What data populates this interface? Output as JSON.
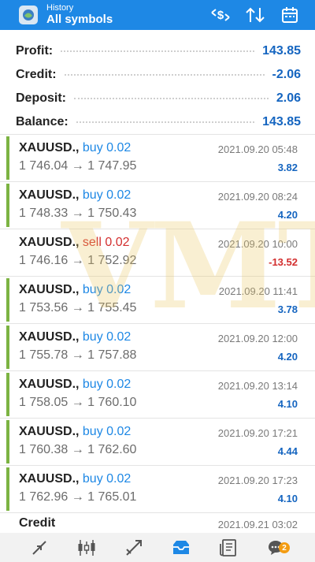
{
  "header": {
    "supertitle": "History",
    "title": "All symbols",
    "icons": [
      "currency-filter-icon",
      "sort-icon",
      "calendar-icon"
    ]
  },
  "summary": {
    "profit": {
      "label": "Profit:",
      "value": "143.85"
    },
    "credit": {
      "label": "Credit:",
      "value": "-2.06"
    },
    "deposit": {
      "label": "Deposit:",
      "value": "2.06"
    },
    "balance": {
      "label": "Balance:",
      "value": "143.85"
    }
  },
  "deals": [
    {
      "symbol": "XAUUSD.,",
      "action": "buy 0.02",
      "type": "buy",
      "prices": "1 746.04 → 1 747.95",
      "time": "2021.09.20 05:48",
      "profit": "3.82"
    },
    {
      "symbol": "XAUUSD.,",
      "action": "buy 0.02",
      "type": "buy",
      "prices": "1 748.33 → 1 750.43",
      "time": "2021.09.20 08:24",
      "profit": "4.20"
    },
    {
      "symbol": "XAUUSD.,",
      "action": "sell 0.02",
      "type": "sell",
      "prices": "1 746.16 → 1 752.92",
      "time": "2021.09.20 10:00",
      "profit": "-13.52"
    },
    {
      "symbol": "XAUUSD.,",
      "action": "buy 0.02",
      "type": "buy",
      "prices": "1 753.56 → 1 755.45",
      "time": "2021.09.20 11:41",
      "profit": "3.78"
    },
    {
      "symbol": "XAUUSD.,",
      "action": "buy 0.02",
      "type": "buy",
      "prices": "1 755.78 → 1 757.88",
      "time": "2021.09.20 12:00",
      "profit": "4.20"
    },
    {
      "symbol": "XAUUSD.,",
      "action": "buy 0.02",
      "type": "buy",
      "prices": "1 758.05 → 1 760.10",
      "time": "2021.09.20 13:14",
      "profit": "4.10"
    },
    {
      "symbol": "XAUUSD.,",
      "action": "buy 0.02",
      "type": "buy",
      "prices": "1 760.38 → 1 762.60",
      "time": "2021.09.20 17:21",
      "profit": "4.44"
    },
    {
      "symbol": "XAUUSD.,",
      "action": "buy 0.02",
      "type": "buy",
      "prices": "1 762.96 → 1 765.01",
      "time": "2021.09.20 17:23",
      "profit": "4.10"
    }
  ],
  "credit_entry": {
    "label": "Credit",
    "time": "2021.09.21 03:02"
  },
  "watermark": "VMT",
  "bottom_nav": {
    "items": [
      "quotes-icon",
      "chart-icon",
      "trade-icon",
      "history-icon",
      "news-icon",
      "messages-icon"
    ],
    "active": "history-icon",
    "messages_badge": "2"
  },
  "colors": {
    "header": "#1e88e5",
    "buy": "#1e88e5",
    "sell": "#d32f2f",
    "profit_positive": "#1565c0",
    "profit_negative": "#d32f2f",
    "deal_bar": "#7cb342"
  }
}
